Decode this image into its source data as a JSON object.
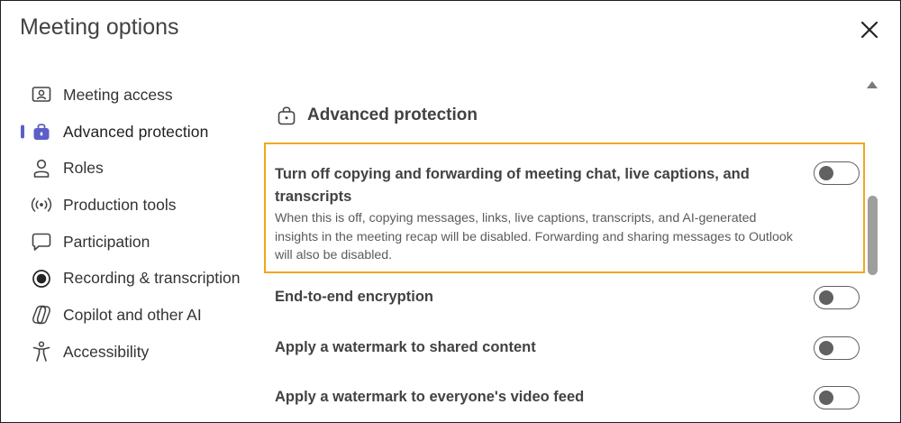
{
  "dialog": {
    "title": "Meeting options"
  },
  "sidebar": {
    "items": [
      {
        "label": "Meeting access",
        "icon": "id-card-icon"
      },
      {
        "label": "Advanced protection",
        "icon": "lock-bag-icon",
        "active": true
      },
      {
        "label": "Roles",
        "icon": "person-icon"
      },
      {
        "label": "Production tools",
        "icon": "broadcast-icon"
      },
      {
        "label": "Participation",
        "icon": "chat-bubble-icon"
      },
      {
        "label": "Recording & transcription",
        "icon": "record-icon"
      },
      {
        "label": "Copilot and other AI",
        "icon": "copilot-icon"
      },
      {
        "label": "Accessibility",
        "icon": "accessibility-icon"
      }
    ]
  },
  "content": {
    "section_title": "Advanced protection",
    "settings": [
      {
        "title_line1": "Turn off copying and forwarding of meeting chat, live captions, and",
        "title_line2": "transcripts",
        "description": "When this is off, copying messages, links, live captions, transcripts, and AI-generated insights in the meeting recap will be disabled. Forwarding and sharing messages to Outlook will also be disabled.",
        "enabled": false
      },
      {
        "title": "End-to-end encryption",
        "enabled": false
      },
      {
        "title": "Apply a watermark to shared content",
        "enabled": false
      },
      {
        "title": "Apply a watermark to everyone's video feed",
        "enabled": false
      }
    ]
  },
  "colors": {
    "accent": "#5b5fc7",
    "highlight": "#f2a81d",
    "text": "#424242"
  }
}
